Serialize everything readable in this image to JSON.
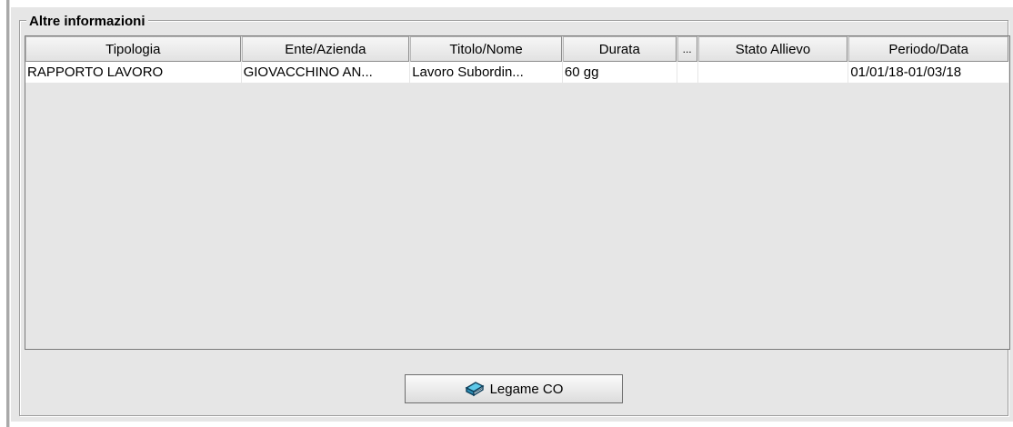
{
  "group": {
    "title": "Altre informazioni"
  },
  "table": {
    "columns": [
      "Tipologia",
      "Ente/Azienda",
      "Titolo/Nome",
      "Durata",
      "...",
      "Stato Allievo",
      "Periodo/Data"
    ],
    "rows": [
      [
        "RAPPORTO LAVORO",
        "GIOVACCHINO AN...",
        "Lavoro Subordin...",
        "60 gg",
        "",
        "",
        "01/01/18-01/03/18"
      ]
    ]
  },
  "button": {
    "label": "Legame CO",
    "icon": "book-icon"
  }
}
